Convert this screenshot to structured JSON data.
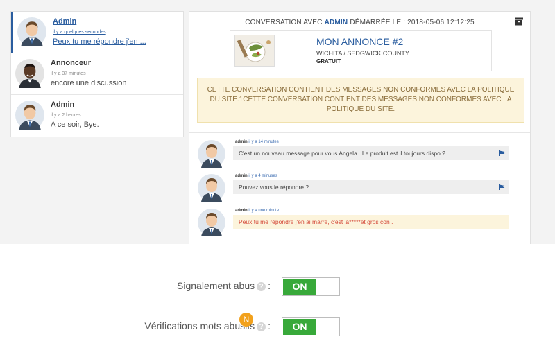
{
  "conversations": [
    {
      "name": "Admin",
      "time": "il y a quelques secondes",
      "message": "Peux tu me répondre j'en ...",
      "active": true
    },
    {
      "name": "Annonceur",
      "time": "il y a 37 minutes",
      "message": "encore une discussion",
      "active": false
    },
    {
      "name": "Admin",
      "time": "il y a 2 heures",
      "message": "A ce soir, Bye.",
      "active": false
    }
  ],
  "header": {
    "prefix": "CONVERSATION AVEC",
    "user": "ADMIN",
    "suffix": "DÉMARRÉE LE : 2018-05-06 12:12:25"
  },
  "ad": {
    "title": "MON ANNONCE #2",
    "location": "WICHITA / SEDGWICK COUNTY",
    "price": "GRATUIT"
  },
  "warning": "CETTE CONVERSATION CONTIENT DES MESSAGES NON CONFORMES AVEC LA POLITIQUE DU SITE.1CETTE CONVERSATION CONTIENT DES MESSAGES NON CONFORMES AVEC LA POLITIQUE DU SITE.",
  "messages": [
    {
      "author": "admin",
      "time": "il y a 14 minutes",
      "text": "C'est un nouveau message pour vous Angela . Le produit est il toujours dispo ?",
      "flagged": false
    },
    {
      "author": "admin",
      "time": "il y a 4 minuses",
      "text": "Pouvez vous le répondre ?",
      "flagged": false
    },
    {
      "author": "admin",
      "time": "il y a une minute",
      "text": "Peux tu me répondre j'en ai marre, c'est la*****et gros con .",
      "flagged": true
    }
  ],
  "settings": {
    "abuse_report": {
      "label": "Signalement abus",
      "sep": ":",
      "state": "ON"
    },
    "word_check": {
      "label": "Vérifications mots abusifs",
      "sep": ":",
      "state": "ON",
      "badge": "N"
    },
    "help_glyph": "?"
  },
  "colors": {
    "accent": "#2a5d9f",
    "toggle_on": "#38a93a",
    "warning_bg": "#fcf4dc",
    "abusive_text": "#d44a3a",
    "badge": "#f2a11c"
  },
  "icons": [
    "avatar",
    "archive-icon",
    "flag-icon",
    "help-icon"
  ]
}
